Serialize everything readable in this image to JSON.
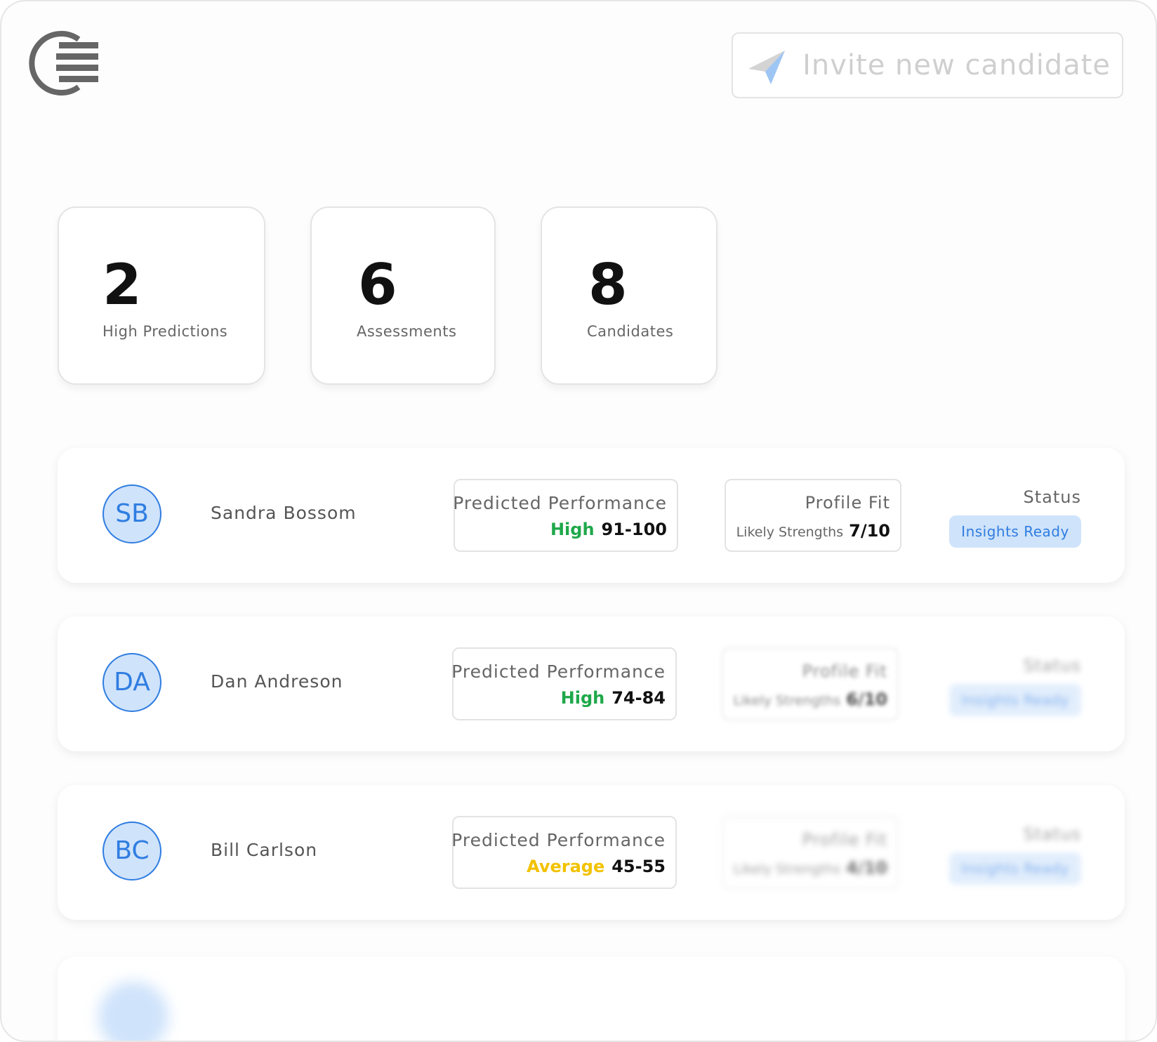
{
  "header": {
    "logo_icon": "app-logo",
    "invite_button": {
      "label": "Invite new candidate",
      "icon": "paper-plane-icon"
    }
  },
  "stats": [
    {
      "value": "2",
      "label": "High Predictions"
    },
    {
      "value": "6",
      "label": "Assessments"
    },
    {
      "value": "8",
      "label": "Candidates"
    }
  ],
  "candidates": [
    {
      "initials": "SB",
      "name": "Sandra Bossom",
      "performance": {
        "title": "Predicted Performance",
        "level": "High",
        "level_color": "#1fa84a",
        "range": "91-100"
      },
      "fit": {
        "title": "Profile Fit",
        "label": "Likely Strengths",
        "score": "7/10"
      },
      "status": {
        "label": "Status",
        "value": "Insights Ready"
      }
    },
    {
      "initials": "DA",
      "name": "Dan Andreson",
      "performance": {
        "title": "Predicted Performance",
        "level": "High",
        "level_color": "#1fa84a",
        "range": "74-84"
      },
      "fit": {
        "title": "Profile Fit",
        "label": "Likely Strengths",
        "score": "6/10"
      },
      "status": {
        "label": "Status",
        "value": "Insights Ready"
      }
    },
    {
      "initials": "BC",
      "name": "Bill Carlson",
      "performance": {
        "title": "Predicted Performance",
        "level": "Average",
        "level_color": "#f2c200",
        "range": "45-55"
      },
      "fit": {
        "title": "Profile Fit",
        "label": "Likely Strengths",
        "score": "4/10"
      },
      "status": {
        "label": "Status",
        "value": "Insights Ready"
      }
    }
  ],
  "colors": {
    "accent": "#2f7de1",
    "badge_bg": "#cfe3fb",
    "high": "#1fa84a",
    "average": "#f2c200"
  }
}
